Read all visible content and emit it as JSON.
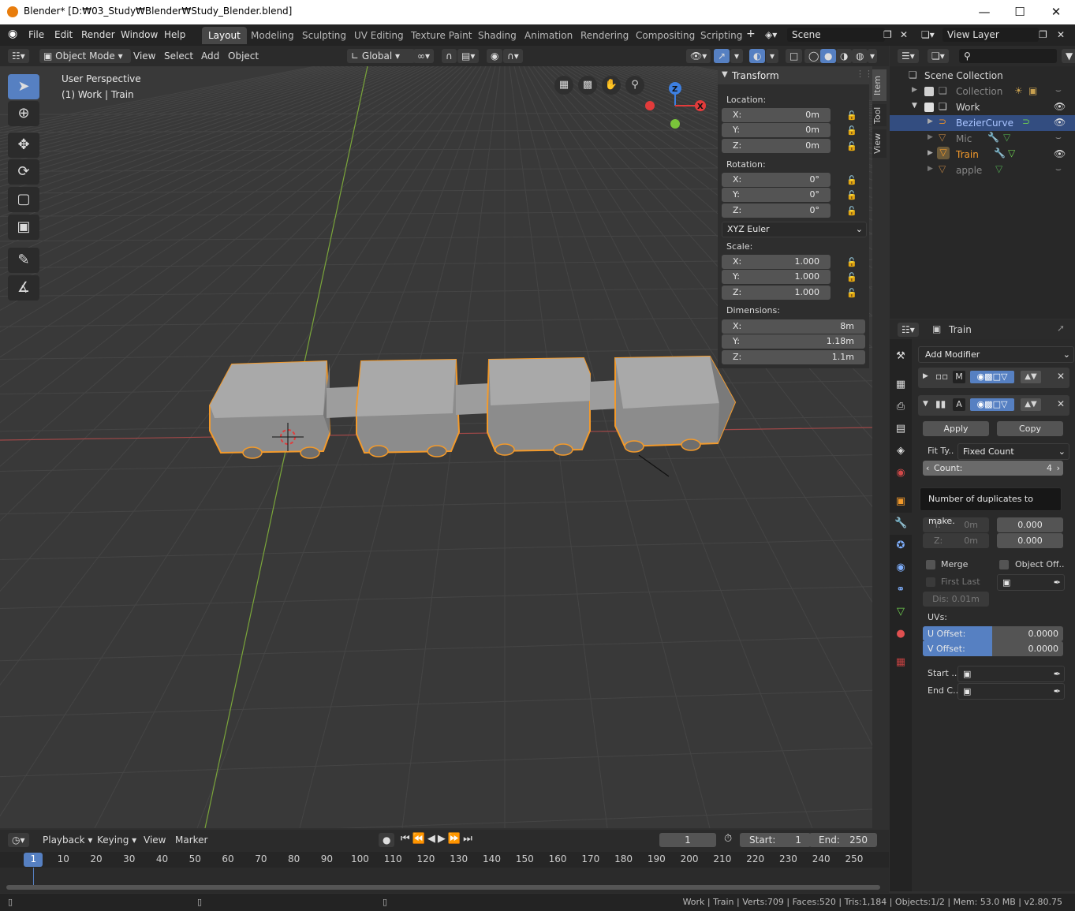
{
  "window": {
    "title": "Blender* [D:₩03_Study₩Blender₩Study_Blender.blend]",
    "minimize": "—",
    "maximize": "☐",
    "close": "✕"
  },
  "menu": [
    "File",
    "Edit",
    "Render",
    "Window",
    "Help"
  ],
  "workspaces": [
    "Layout",
    "Modeling",
    "Sculpting",
    "UV Editing",
    "Texture Paint",
    "Shading",
    "Animation",
    "Rendering",
    "Compositing",
    "Scripting"
  ],
  "active_workspace": "Layout",
  "scene": "Scene",
  "view_layer": "View Layer",
  "header": {
    "mode": "Object Mode",
    "view": "View",
    "select": "Select",
    "add": "Add",
    "object": "Object",
    "orientation": "Global"
  },
  "viewport": {
    "perspective": "User Perspective",
    "collection_info": "(1) Work | Train",
    "gizmo_x": "X",
    "gizmo_y": "Y",
    "gizmo_z": "Z"
  },
  "side_tabs": [
    "Item",
    "Tool",
    "View"
  ],
  "transform": {
    "title": "Transform",
    "location_label": "Location:",
    "location": [
      {
        "axis": "X:",
        "value": "0m"
      },
      {
        "axis": "Y:",
        "value": "0m"
      },
      {
        "axis": "Z:",
        "value": "0m"
      }
    ],
    "rotation_label": "Rotation:",
    "rotation": [
      {
        "axis": "X:",
        "value": "0°"
      },
      {
        "axis": "Y:",
        "value": "0°"
      },
      {
        "axis": "Z:",
        "value": "0°"
      }
    ],
    "rotation_mode": "XYZ Euler",
    "scale_label": "Scale:",
    "scale": [
      {
        "axis": "X:",
        "value": "1.000"
      },
      {
        "axis": "Y:",
        "value": "1.000"
      },
      {
        "axis": "Z:",
        "value": "1.000"
      }
    ],
    "dimensions_label": "Dimensions:",
    "dimensions": [
      {
        "axis": "X:",
        "value": "8m"
      },
      {
        "axis": "Y:",
        "value": "1.18m"
      },
      {
        "axis": "Z:",
        "value": "1.1m"
      }
    ]
  },
  "outliner": {
    "root": "Scene Collection",
    "items": [
      {
        "name": "Collection"
      },
      {
        "name": "Work"
      },
      {
        "name": "BezierCurve"
      },
      {
        "name": "Mic"
      },
      {
        "name": "Train"
      },
      {
        "name": "apple"
      }
    ]
  },
  "properties": {
    "object_name": "Train",
    "add_modifier": "Add Modifier",
    "mod1_letter": "M",
    "mod2_letter": "A",
    "apply": "Apply",
    "copy": "Copy",
    "fit_type_label": "Fit Ty..",
    "fit_type_value": "Fixed Count",
    "count_label": "Count:",
    "count_value": "4",
    "tooltip": "Number of duplicates to make.",
    "y_label": "Y:",
    "y_value": "0m",
    "y_rel": "0.000",
    "z_label": "Z:",
    "z_value": "0m",
    "z_rel": "0.000",
    "merge": "Merge",
    "object_offset": "Object Off..",
    "first_last": "First Last",
    "distance": "Dis: 0.01m",
    "uvs_label": "UVs:",
    "u_offset_label": "U Offset:",
    "u_offset_value": "0.0000",
    "v_offset_label": "V Offset:",
    "v_offset_value": "0.0000",
    "start_cap": "Start ..",
    "end_cap": "End C.."
  },
  "timeline": {
    "playback": "Playback",
    "keying": "Keying",
    "view": "View",
    "marker": "Marker",
    "current_frame": "1",
    "start_label": "Start:",
    "start_value": "1",
    "end_label": "End:",
    "end_value": "250",
    "frames": [
      "1",
      "10",
      "20",
      "30",
      "40",
      "50",
      "60",
      "70",
      "80",
      "90",
      "100",
      "110",
      "120",
      "130",
      "140",
      "150",
      "160",
      "170",
      "180",
      "190",
      "200",
      "210",
      "220",
      "230",
      "240",
      "250"
    ]
  },
  "status": "Work | Train | Verts:709 | Faces:520 | Tris:1,184 | Objects:1/2 | Mem: 53.0 MB | v2.80.75",
  "colors": {
    "accent": "#5680c2",
    "selection": "#f39a2b",
    "bg": "#393939"
  }
}
